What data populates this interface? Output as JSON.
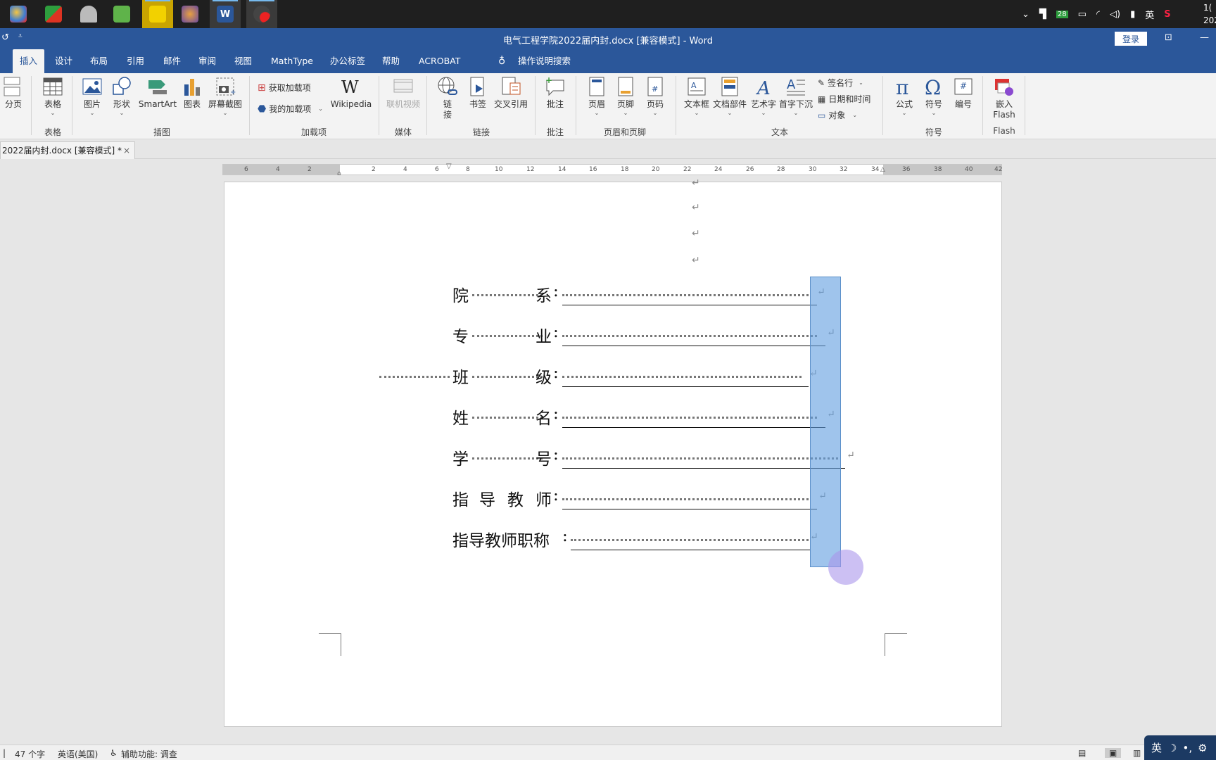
{
  "taskbar": {
    "tray": {
      "language": "英",
      "badge": "28",
      "clock_partial_1": "1(",
      "clock_partial_2": "202"
    }
  },
  "titlebar": {
    "title": "电气工程学院2022届内封.docx [兼容模式]  -  Word",
    "login": "登录"
  },
  "menu": {
    "tabs": [
      "插入",
      "设计",
      "布局",
      "引用",
      "邮件",
      "审阅",
      "视图",
      "MathType",
      "办公标签",
      "帮助",
      "ACROBAT"
    ],
    "tellme": "操作说明搜索"
  },
  "ribbon": {
    "pagebreak": "分页",
    "table": "表格",
    "table_group": "表格",
    "picture": "图片",
    "shapes": "形状",
    "smartart": "SmartArt",
    "chart": "图表",
    "screenshot": "屏幕截图",
    "illustrations_group": "插图",
    "get_addins": "获取加载项",
    "my_addins": "我的加载项",
    "wikipedia": "Wikipedia",
    "addins_group": "加载项",
    "online_video": "联机视频",
    "media_group": "媒体",
    "link_1": "链",
    "link_2": "接",
    "bookmark": "书签",
    "crossref": "交叉引用",
    "links_group": "链接",
    "comment": "批注",
    "comments_group": "批注",
    "header": "页眉",
    "footer": "页脚",
    "pagenum": "页码",
    "hf_group": "页眉和页脚",
    "textbox": "文本框",
    "quickparts": "文档部件",
    "wordart": "艺术字",
    "dropcap": "首字下沉",
    "sigline": "签名行",
    "datetime": "日期和时间",
    "object": "对象",
    "text_group": "文本",
    "equation": "公式",
    "symbol": "符号",
    "number": "编号",
    "symbols_group": "符号",
    "flash_1": "嵌入",
    "flash_2": "Flash",
    "flash_group": "Flash"
  },
  "doc_tab": {
    "name": "2022届内封.docx [兼容模式] *",
    "close": "×"
  },
  "ruler": {
    "left_ticks": [
      "6",
      "4",
      "2"
    ],
    "ticks": [
      "2",
      "4",
      "6",
      "8",
      "10",
      "12",
      "14",
      "16",
      "18",
      "20",
      "22",
      "24",
      "26",
      "28",
      "30",
      "32",
      "34",
      "36",
      "38",
      "40",
      "42"
    ]
  },
  "form": {
    "mark": "↵",
    "rows": [
      {
        "label": "院",
        "label2": "系",
        "colon": ":"
      },
      {
        "label": "专",
        "label2": "业",
        "colon": ":"
      },
      {
        "label": "班",
        "label2": "级",
        "colon": ":"
      },
      {
        "label": "姓",
        "label2": "名",
        "colon": ":"
      },
      {
        "label": "学",
        "label2": "号",
        "colon": ":"
      },
      {
        "label": "指",
        "label2": "导",
        "label3": "教",
        "label4": "师",
        "colon": ":"
      },
      {
        "label": "指导教师职称",
        "colon": ":"
      }
    ]
  },
  "statusbar": {
    "words": "47 个字",
    "language": "英语(美国)",
    "accessibility": "辅助功能: 调查"
  },
  "ime": {
    "lang": "英"
  }
}
